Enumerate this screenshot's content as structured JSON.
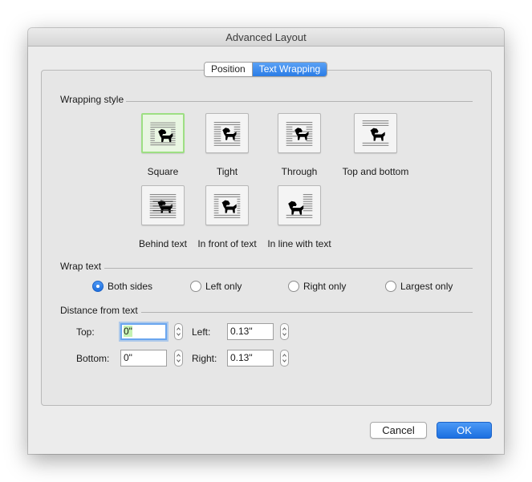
{
  "window": {
    "title": "Advanced Layout"
  },
  "tabs": [
    {
      "label": "Position",
      "active": false
    },
    {
      "label": "Text Wrapping",
      "active": true
    }
  ],
  "wrapping_style": {
    "section_label": "Wrapping style",
    "selected": "Square",
    "options": [
      {
        "label": "Square",
        "icon": "wrap-square-icon"
      },
      {
        "label": "Tight",
        "icon": "wrap-tight-icon"
      },
      {
        "label": "Through",
        "icon": "wrap-through-icon"
      },
      {
        "label": "Top and bottom",
        "icon": "wrap-top-bottom-icon"
      },
      {
        "label": "Behind text",
        "icon": "wrap-behind-text-icon"
      },
      {
        "label": "In front of text",
        "icon": "wrap-in-front-icon"
      },
      {
        "label": "In line with text",
        "icon": "wrap-inline-icon"
      }
    ]
  },
  "wrap_text": {
    "section_label": "Wrap text",
    "selected": "Both sides",
    "options": [
      "Both sides",
      "Left only",
      "Right only",
      "Largest only"
    ]
  },
  "distance": {
    "section_label": "Distance from text",
    "top_label": "Top:",
    "top_value": "0\"",
    "bottom_label": "Bottom:",
    "bottom_value": "0\"",
    "left_label": "Left:",
    "left_value": "0.13\"",
    "right_label": "Right:",
    "right_value": "0.13\""
  },
  "buttons": {
    "cancel": "Cancel",
    "ok": "OK"
  },
  "colors": {
    "accent": "#2a7ce6",
    "selected_border": "#9ddf83",
    "selection_highlight": "#c5f2b2"
  }
}
